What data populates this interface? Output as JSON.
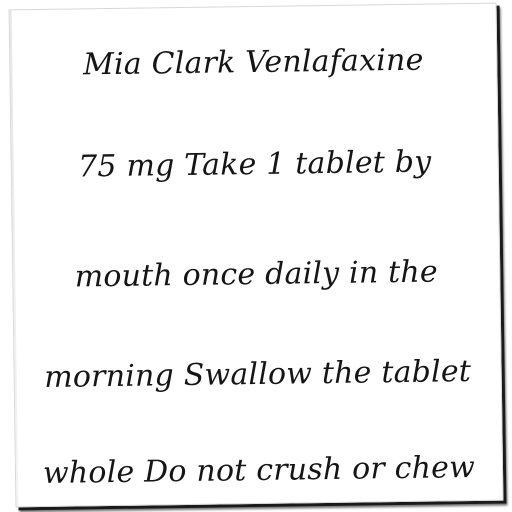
{
  "document": {
    "lines": [
      "Mia Clark Venlafaxine",
      "75 mg Take 1 tablet by",
      "mouth once daily in the",
      "morning Swallow the tablet",
      "whole Do not crush or chew"
    ]
  }
}
